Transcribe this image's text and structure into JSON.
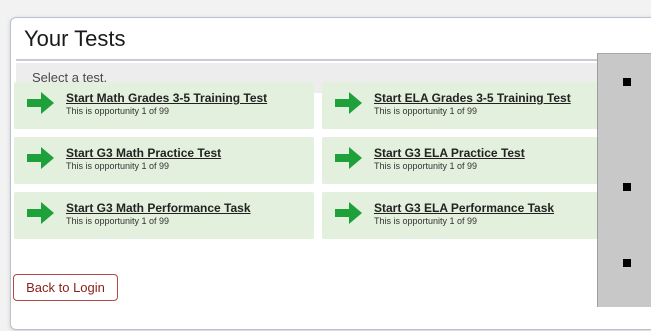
{
  "header": {
    "title": "Your Tests",
    "subheader": "Select a test."
  },
  "tests": [
    {
      "label": "Start Math Grades 3-5 Training Test",
      "opportunity": "This is opportunity 1 of 99"
    },
    {
      "label": "Start ELA Grades 3-5 Training Test",
      "opportunity": "This is opportunity 1 of 99"
    },
    {
      "label": "Start G3 Math Practice Test",
      "opportunity": "This is opportunity 1 of 99"
    },
    {
      "label": "Start G3 ELA Practice Test",
      "opportunity": "This is opportunity 1 of 99"
    },
    {
      "label": "Start G3 Math Performance Task",
      "opportunity": "This is opportunity 1 of 99"
    },
    {
      "label": "Start G3 ELA Performance Task",
      "opportunity": "This is opportunity 1 of 99"
    }
  ],
  "footer": {
    "back_label": "Back to Login"
  },
  "icons": {
    "tile_arrow": "arrow-right-icon",
    "overlay_bullet": "square-bullet-icon"
  },
  "colors": {
    "tile_background": "#e3f0dd",
    "arrow_green": "#1ea03a",
    "back_button_border": "#b04a42",
    "back_button_text": "#8a1f17"
  }
}
